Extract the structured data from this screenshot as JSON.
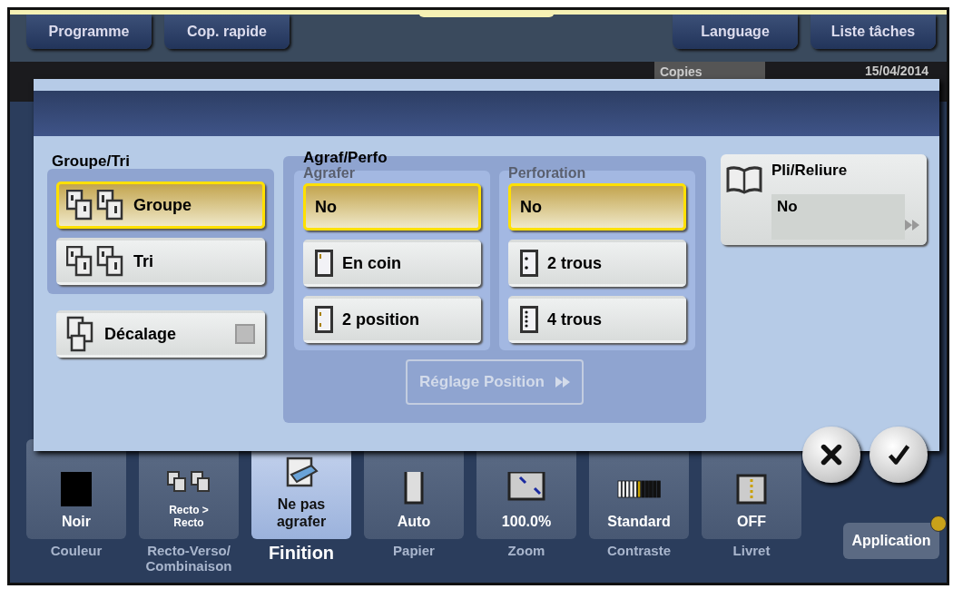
{
  "top_buttons_left": [
    {
      "label": "Programme"
    },
    {
      "label": "Cop. rapide"
    }
  ],
  "top_buttons_right": [
    {
      "label": "Language"
    },
    {
      "label": "Liste tâches"
    }
  ],
  "status": {
    "copies_label": "Copies",
    "date": "15/04/2014"
  },
  "dialog": {
    "groupe_tri": {
      "title": "Groupe/Tri",
      "options": [
        {
          "label": "Groupe",
          "kind": "group",
          "selected": true
        },
        {
          "label": "Tri",
          "kind": "sort",
          "selected": false
        }
      ]
    },
    "decalage": {
      "label": "Décalage",
      "checked": false
    },
    "agraf_perfo": {
      "title": "Agraf/Perfo",
      "agrafer": {
        "title": "Agrafer",
        "options": [
          {
            "label": "No",
            "kind": "none",
            "selected": true
          },
          {
            "label": "En coin",
            "kind": "corner",
            "selected": false
          },
          {
            "label": "2 position",
            "kind": "two-staples",
            "selected": false
          }
        ]
      },
      "perforation": {
        "title": "Perforation",
        "options": [
          {
            "label": "No",
            "kind": "none",
            "selected": true
          },
          {
            "label": "2 trous",
            "kind": "two-holes",
            "selected": false
          },
          {
            "label": "4 trous",
            "kind": "four-holes",
            "selected": false
          }
        ]
      },
      "position_button": {
        "label": "Réglage Position",
        "disabled": true
      }
    },
    "pli_reliure": {
      "title": "Pli/Reliure",
      "value": "No"
    }
  },
  "functions": [
    {
      "value": "Noir",
      "label": "Couleur",
      "kind": "color",
      "selected": false
    },
    {
      "value": "Recto > Recto",
      "label": "Recto-Verso/ Combinaison",
      "kind": "duplex",
      "selected": false
    },
    {
      "value": "Ne pas agrafer",
      "label": "Finition",
      "kind": "finishing",
      "selected": true
    },
    {
      "value": "Auto",
      "label": "Papier",
      "kind": "paper",
      "selected": false
    },
    {
      "value": "100.0%",
      "label": "Zoom",
      "kind": "zoom",
      "selected": false
    },
    {
      "value": "Standard",
      "label": "Contraste",
      "kind": "contrast",
      "selected": false
    },
    {
      "value": "OFF",
      "label": "Livret",
      "kind": "booklet",
      "selected": false
    }
  ],
  "application": {
    "label": "Application"
  }
}
